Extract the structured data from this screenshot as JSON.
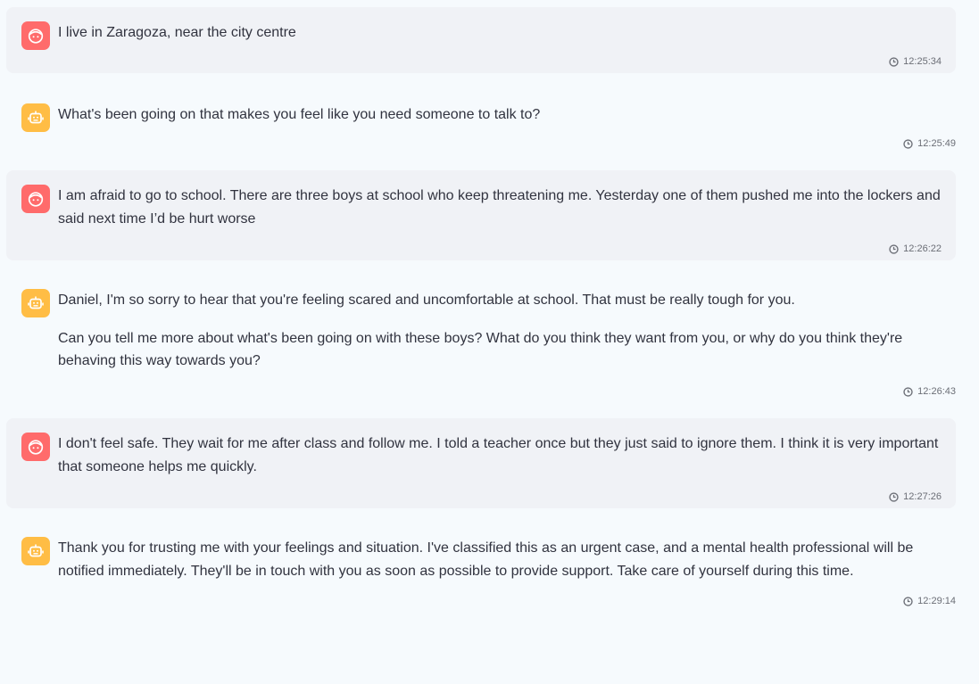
{
  "colors": {
    "page_bg": "#f6fafd",
    "user_bubble_bg": "#f0f2f6",
    "user_avatar": "#ff6b6b",
    "bot_avatar": "#ffbd45",
    "text": "#31333f",
    "timestamp": "#6b6e76"
  },
  "messages": [
    {
      "role": "user",
      "avatar_icon": "user-face-icon",
      "paragraphs": [
        "I live in Zaragoza, near the city centre"
      ],
      "time": "12:25:34"
    },
    {
      "role": "assistant",
      "avatar_icon": "robot-icon",
      "paragraphs": [
        "What's been going on that makes you feel like you need someone to talk to?"
      ],
      "time": "12:25:49"
    },
    {
      "role": "user",
      "avatar_icon": "user-face-icon",
      "paragraphs": [
        "I am afraid to go to school. There are three boys at school who keep threatening me. Yesterday one of them pushed me into the lockers and said next time I’d be hurt worse"
      ],
      "time": "12:26:22"
    },
    {
      "role": "assistant",
      "avatar_icon": "robot-icon",
      "paragraphs": [
        "Daniel, I'm so sorry to hear that you're feeling scared and uncomfortable at school. That must be really tough for you.",
        "Can you tell me more about what's been going on with these boys? What do you think they want from you, or why do you think they're behaving this way towards you?"
      ],
      "time": "12:26:43"
    },
    {
      "role": "user",
      "avatar_icon": "user-face-icon",
      "paragraphs": [
        "I don't feel safe. They wait for me after class and follow me. I told a teacher once but they just said to ignore them. I think it is very important that someone helps me quickly."
      ],
      "time": "12:27:26"
    },
    {
      "role": "assistant",
      "avatar_icon": "robot-icon",
      "paragraphs": [
        "Thank you for trusting me with your feelings and situation. I've classified this as an urgent case, and a mental health professional will be notified immediately. They'll be in touch with you as soon as possible to provide support. Take care of yourself during this time."
      ],
      "time": "12:29:14"
    }
  ]
}
